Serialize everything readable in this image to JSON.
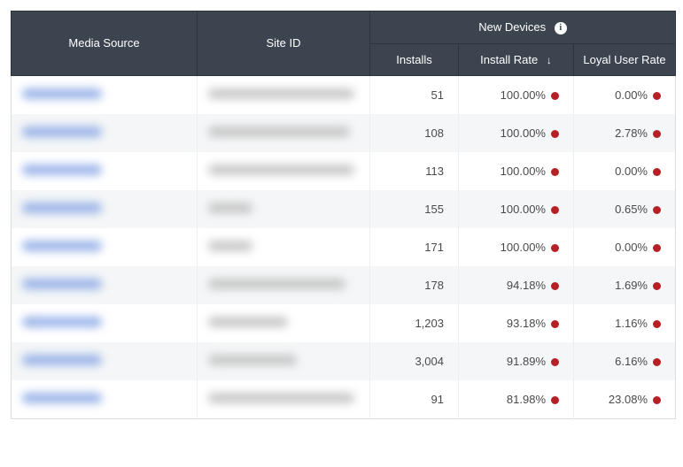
{
  "headers": {
    "media_source": "Media Source",
    "site_id": "Site ID",
    "new_devices": "New Devices",
    "installs": "Installs",
    "install_rate": "Install Rate",
    "loyal_user_rate": "Loyal User Rate"
  },
  "rows": [
    {
      "installs": "51",
      "install_rate": "100.00%",
      "loyal_user_rate": "0.00%",
      "site_w": 165
    },
    {
      "installs": "108",
      "install_rate": "100.00%",
      "loyal_user_rate": "2.78%",
      "site_w": 160
    },
    {
      "installs": "113",
      "install_rate": "100.00%",
      "loyal_user_rate": "0.00%",
      "site_w": 165
    },
    {
      "installs": "155",
      "install_rate": "100.00%",
      "loyal_user_rate": "0.65%",
      "site_w": 50
    },
    {
      "installs": "171",
      "install_rate": "100.00%",
      "loyal_user_rate": "0.00%",
      "site_w": 50
    },
    {
      "installs": "178",
      "install_rate": "94.18%",
      "loyal_user_rate": "1.69%",
      "site_w": 155
    },
    {
      "installs": "1,203",
      "install_rate": "93.18%",
      "loyal_user_rate": "1.16%",
      "site_w": 90
    },
    {
      "installs": "3,004",
      "install_rate": "91.89%",
      "loyal_user_rate": "6.16%",
      "site_w": 100
    },
    {
      "installs": "91",
      "install_rate": "81.98%",
      "loyal_user_rate": "23.08%",
      "site_w": 165
    }
  ]
}
